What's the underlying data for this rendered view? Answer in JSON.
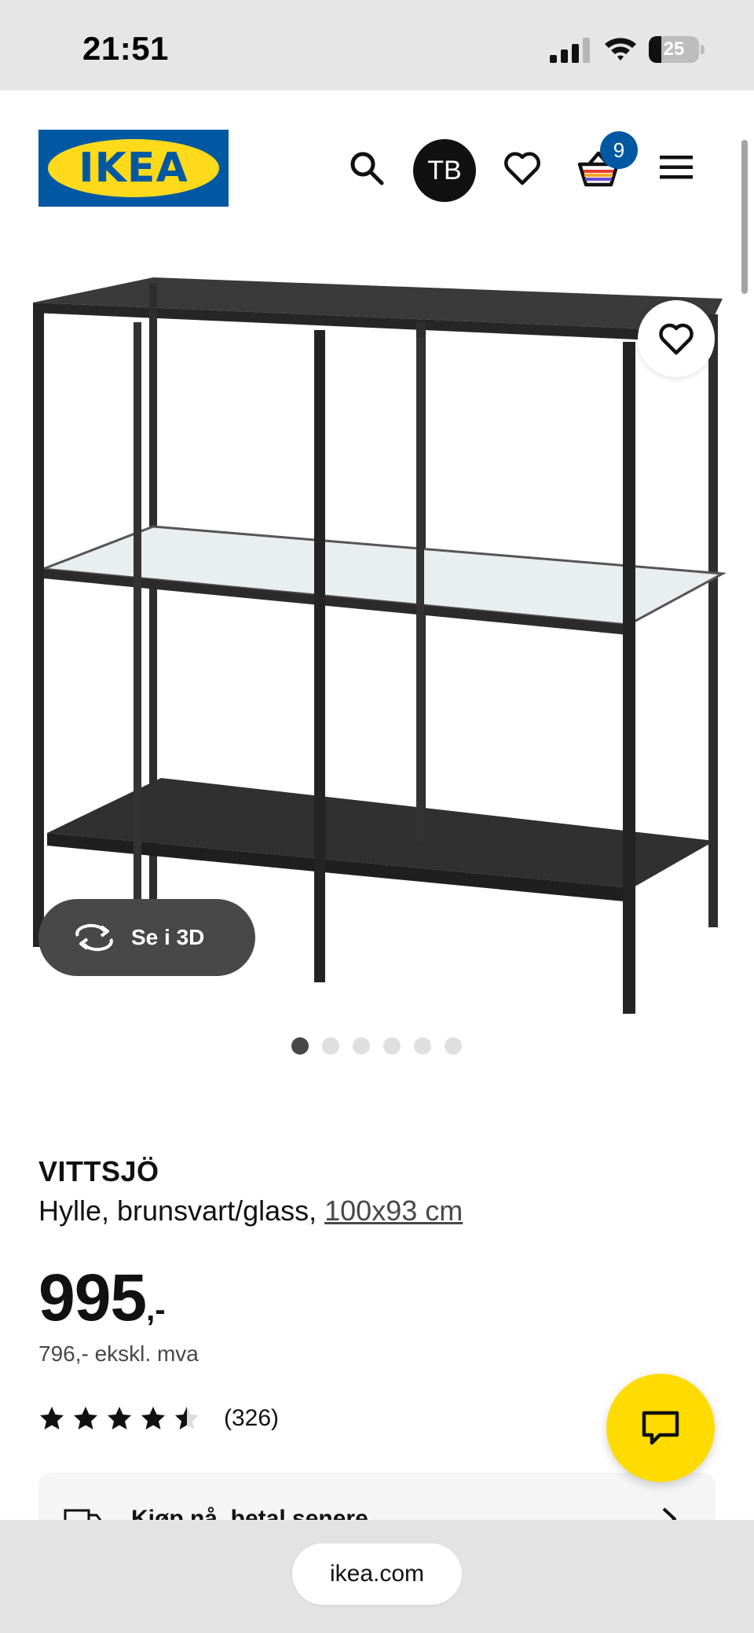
{
  "status_bar": {
    "time": "21:51",
    "battery_level": "25",
    "battery_fraction": 0.25
  },
  "header": {
    "logo_text": "IKEA",
    "avatar_initials": "TB",
    "cart_count": "9",
    "icons": [
      "search-icon",
      "heart-icon",
      "basket-icon",
      "hamburger-menu-icon"
    ]
  },
  "gallery": {
    "view_3d_label": "Se i 3D",
    "image_count": 6,
    "active_index": 0
  },
  "product": {
    "name": "VITTSJÖ",
    "description": "Hylle, brunsvart/glass, ",
    "size": "100x93 cm",
    "price": "995",
    "price_suffix": ",-",
    "price_ex_vat": "796,- ekskl. mva",
    "rating": 4.5,
    "review_count": "(326)"
  },
  "klarna": {
    "label": "Kjøp nå, betal senere"
  },
  "browser": {
    "url": "ikea.com"
  },
  "colors": {
    "ikea_blue": "#0058a3",
    "ikea_yellow": "#ffda1a",
    "chat_yellow": "#ffdb00",
    "dark": "#484848"
  }
}
